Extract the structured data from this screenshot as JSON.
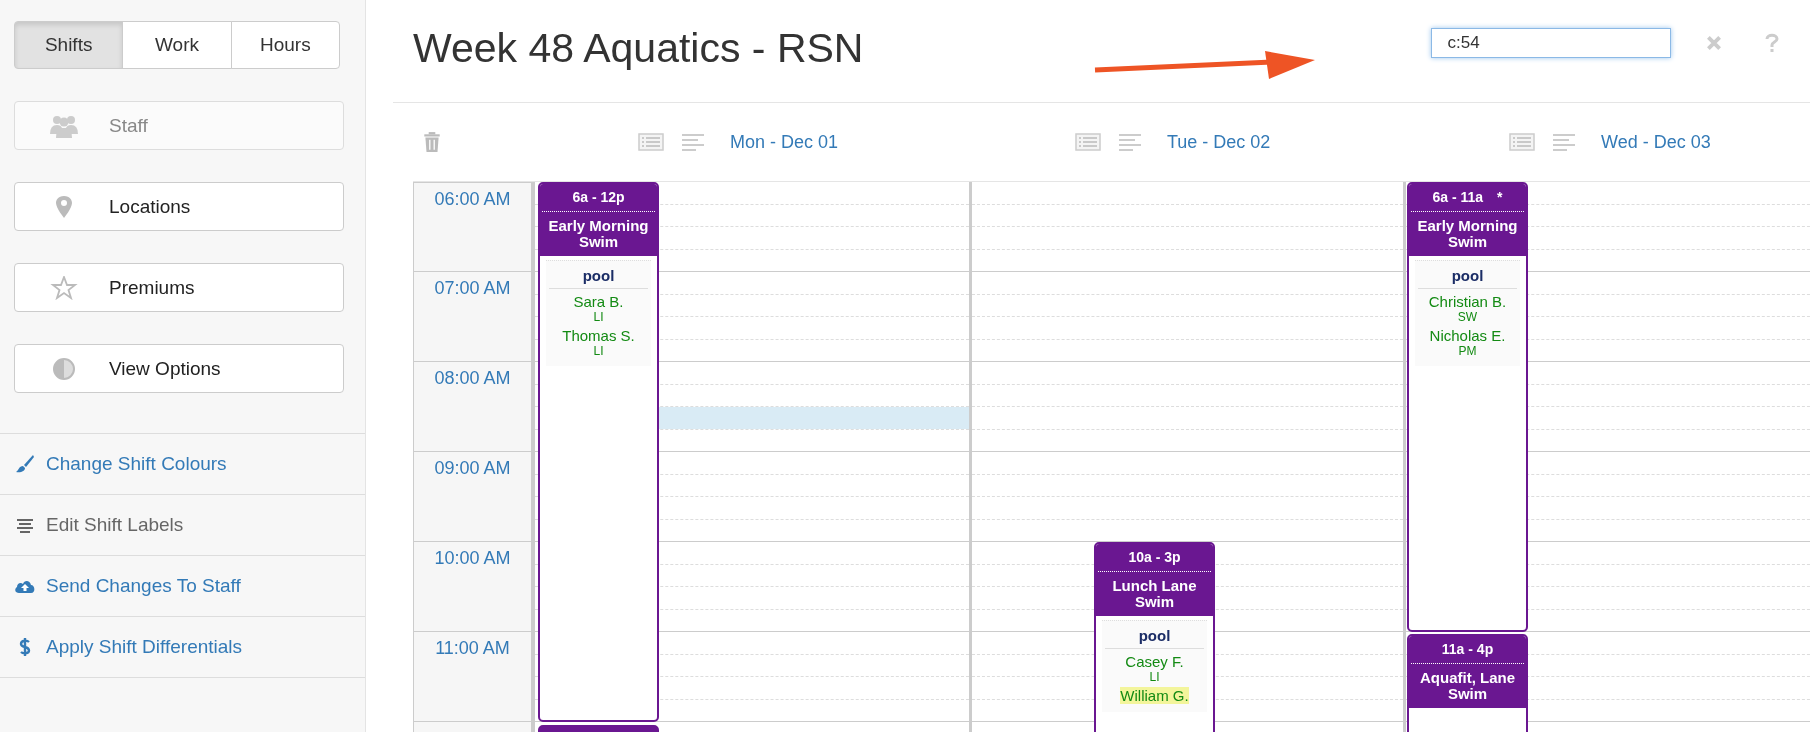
{
  "sidebar": {
    "view_tabs": [
      {
        "label": "Shifts",
        "selected": true
      },
      {
        "label": "Work",
        "selected": false
      },
      {
        "label": "Hours",
        "selected": false
      }
    ],
    "buttons": [
      {
        "label": "Staff",
        "disabled": true
      },
      {
        "label": "Locations",
        "disabled": false
      },
      {
        "label": "Premiums",
        "disabled": false
      },
      {
        "label": "View Options",
        "disabled": false
      }
    ],
    "links": [
      {
        "label": "Change Shift Colours",
        "disabled": false
      },
      {
        "label": "Edit Shift Labels",
        "disabled": true
      },
      {
        "label": "Send Changes To Staff",
        "disabled": false
      },
      {
        "label": "Apply Shift Differentials",
        "disabled": false
      }
    ]
  },
  "header": {
    "title": "Week 48 Aquatics - RSN",
    "search": {
      "value": "c:54"
    }
  },
  "times": [
    "06:00 AM",
    "07:00 AM",
    "08:00 AM",
    "09:00 AM",
    "10:00 AM",
    "11:00 AM"
  ],
  "days": [
    {
      "label": "Mon - Dec 01",
      "has_selection": true,
      "shifts": [
        {
          "kind": "full",
          "time": "6a - 12p",
          "title": "Early Morning Swim",
          "location": "pool",
          "people": [
            {
              "name": "Sara B.",
              "role": "LI",
              "highlighted": false
            },
            {
              "name": "Thomas S.",
              "role": "LI",
              "highlighted": false
            }
          ]
        },
        {
          "kind": "partial"
        }
      ]
    },
    {
      "label": "Tue - Dec 02",
      "shifts": [
        {
          "kind": "full",
          "time": "10a - 3p",
          "title": "Lunch Lane Swim",
          "location": "pool",
          "people": [
            {
              "name": "Casey F.",
              "role": "LI",
              "highlighted": false
            },
            {
              "name": "William G.",
              "highlighted": true
            }
          ]
        }
      ]
    },
    {
      "label": "Wed - Dec 03",
      "shifts": [
        {
          "kind": "full",
          "time": "6a - 11a",
          "flag": "*",
          "title": "Early Morning Swim",
          "location": "pool",
          "people": [
            {
              "name": "Christian B.",
              "role": "SW",
              "highlighted": false
            },
            {
              "name": "Nicholas E.",
              "role": "PM",
              "highlighted": false
            }
          ]
        },
        {
          "kind": "full",
          "time": "11a - 4p",
          "title": "Aquafit, Lane Swim"
        }
      ]
    }
  ]
}
